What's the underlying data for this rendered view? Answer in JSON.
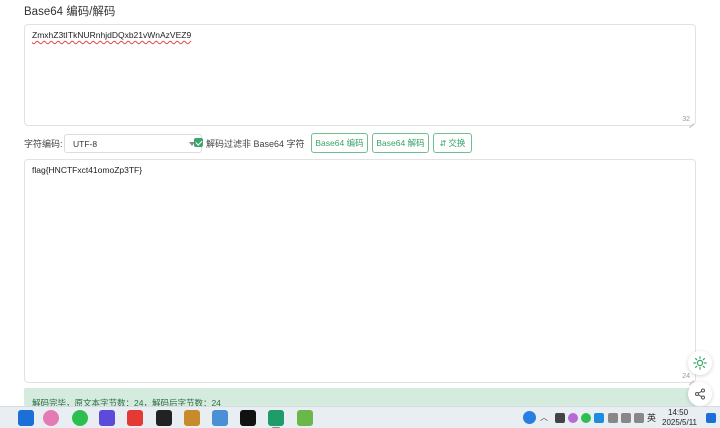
{
  "page": {
    "title": "Base64 编码/解码"
  },
  "input": {
    "value": "ZmxhZ3tITkNURnhjdDQxb21vWnAzVEZ9",
    "char_count": "32"
  },
  "toolbar": {
    "charset_label": "字符编码:",
    "charset_value": "UTF-8",
    "filter_checked": true,
    "filter_label": "解码过滤非 Base64 字符",
    "encode_label": "Base64 编码",
    "decode_label": "Base64 解码",
    "swap_label": "交换"
  },
  "output": {
    "value": "flag{HNCTFxct41omoZp3TF}",
    "char_count": "24"
  },
  "status": {
    "text": "解码完毕，原文本字节数：24，解码后字节数：24"
  },
  "taskbar": {
    "ime_label": "英",
    "time": "14:50",
    "date": "2025/5/11"
  },
  "colors": {
    "accent": "#39a466",
    "status_bg": "#d4ebde",
    "status_text": "#2f6b45"
  }
}
